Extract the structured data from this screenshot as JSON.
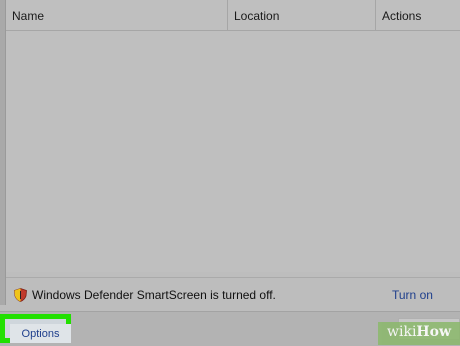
{
  "table": {
    "columns": [
      "Name",
      "Location",
      "Actions"
    ],
    "rows": []
  },
  "status": {
    "message": "Windows Defender SmartScreen is turned off.",
    "action_label": "Turn on",
    "icon": "shield-warning-icon"
  },
  "footer": {
    "options_label": "Options"
  },
  "watermark": {
    "part1": "wiki",
    "part2": "How"
  },
  "colors": {
    "highlight": "#22e000",
    "link": "#1f3f8c",
    "watermark_bg": "#8bb86b"
  }
}
